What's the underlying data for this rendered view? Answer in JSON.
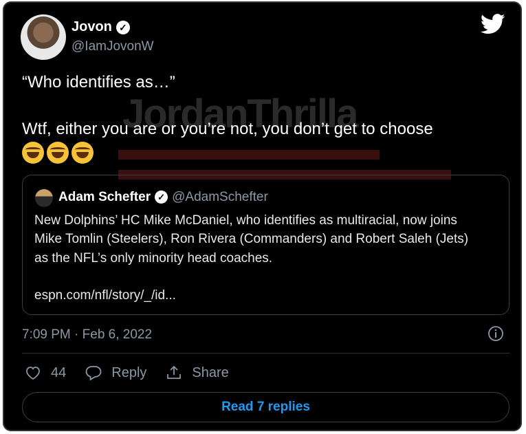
{
  "tweet": {
    "author_name": "Jovon",
    "author_handle": "@IamJovonW",
    "text_line1": "“Who identifies as…”",
    "text_line2": "Wtf, either you are or you’re not, you don’t get to choose",
    "emojis": [
      "rolling-on-floor-laughing",
      "rolling-on-floor-laughing",
      "rolling-on-floor-laughing"
    ],
    "timestamp": "7:09 PM · Feb 6, 2022",
    "watermark": "JordanThrilla"
  },
  "quoted": {
    "author_name": "Adam Schefter",
    "author_handle": "@AdamSchefter",
    "line1": "New Dolphins’ HC Mike McDaniel, who identifies as multiracial, now joins",
    "line2": "Mike Tomlin (Steelers), Ron Rivera (Commanders) and Robert Saleh (Jets)",
    "line3": "as the NFL’s only minority head coaches.",
    "link": "espn.com/nfl/story/_/id..."
  },
  "actions": {
    "like_count": "44",
    "reply_label": "Reply",
    "share_label": "Share",
    "read_replies_label": "Read 7 replies"
  },
  "colors": {
    "background": "#000000",
    "accent": "#1d9bf0",
    "muted": "#8b98a5"
  }
}
